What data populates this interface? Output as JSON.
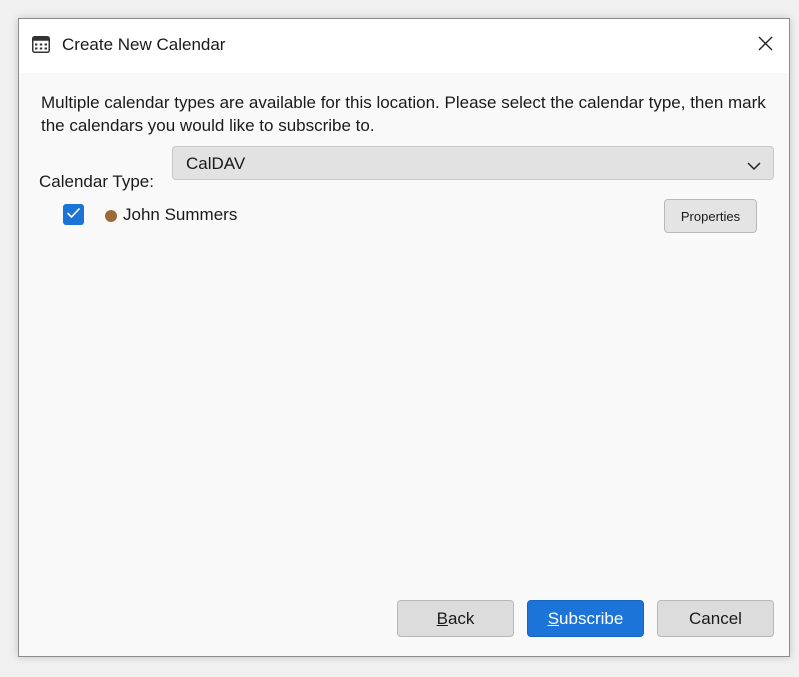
{
  "window": {
    "title": "Create New Calendar",
    "icon": "calendar-icon",
    "close_icon": "close-icon"
  },
  "description": "Multiple calendar types are available for this location. Please select the calendar type, then mark the calendars you would like to subscribe to.",
  "calendar_type": {
    "label": "Calendar Type:",
    "selected": "CalDAV"
  },
  "calendars": [
    {
      "name": "John Summers",
      "checked": true,
      "color": "#9c6a38",
      "properties_label": "Properties"
    }
  ],
  "buttons": {
    "back": {
      "accesskey": "B",
      "rest": "ack"
    },
    "subscribe": {
      "accesskey": "S",
      "rest": "ubscribe"
    },
    "cancel": "Cancel"
  },
  "colors": {
    "accent": "#1c74d9",
    "checkbox": "#1a73d6"
  }
}
